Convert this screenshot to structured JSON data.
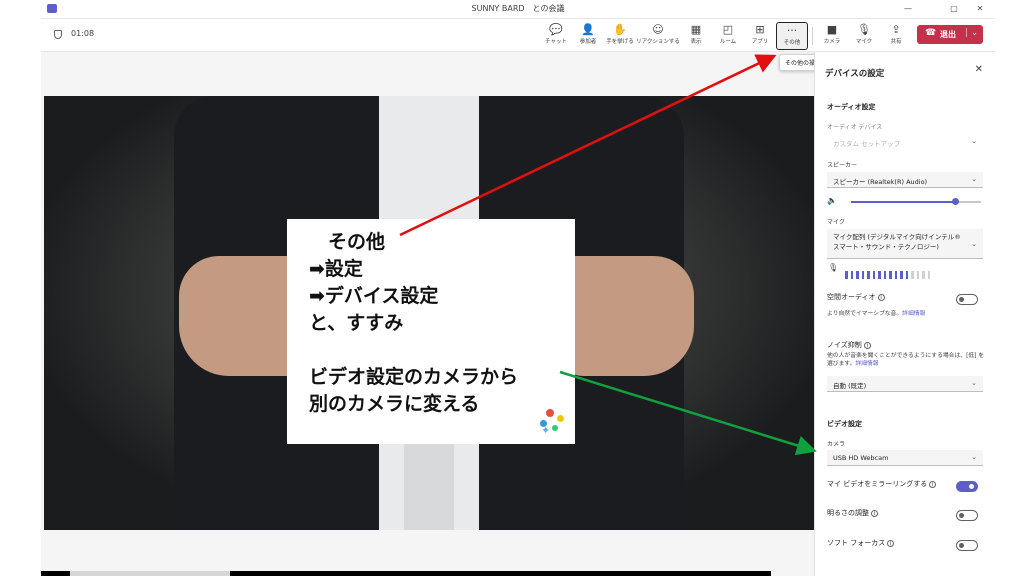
{
  "window": {
    "title": "SUNNY BARD　との会議",
    "minimize": "—",
    "maximize": "▢",
    "close": "✕"
  },
  "toolbar": {
    "timer": "01:08",
    "buttons": [
      {
        "label": "チャット",
        "icon": "chat-icon"
      },
      {
        "label": "参加者",
        "icon": "people-icon"
      },
      {
        "label": "手を挙げる",
        "icon": "raise-hand-icon"
      },
      {
        "label": "リアクションする",
        "icon": "reaction-icon"
      },
      {
        "label": "表示",
        "icon": "view-icon"
      },
      {
        "label": "ルーム",
        "icon": "rooms-icon"
      },
      {
        "label": "アプリ",
        "icon": "apps-icon"
      },
      {
        "label": "その他",
        "icon": "more-icon"
      },
      {
        "label": "カメラ",
        "icon": "camera-icon"
      },
      {
        "label": "マイク",
        "icon": "mic-icon"
      },
      {
        "label": "共有",
        "icon": "share-icon"
      }
    ],
    "leave_label": "退出",
    "more_tooltip": "その他の操作"
  },
  "card": {
    "text": "　その他\n➡設定\n➡デバイス設定\nと、すすみ\n\nビデオ設定のカメラから\n別のカメラに変える"
  },
  "panel": {
    "title": "デバイスの設定",
    "audio_section": "オーディオ設定",
    "audio_device_label": "オーディオ デバイス",
    "audio_device_value": "カスタム セットアップ",
    "speaker_label": "スピーカー",
    "speaker_value": "スピーカー (Realtek(R) Audio)",
    "speaker_volume": 0.8,
    "mic_label": "マイク",
    "mic_value": "マイク配列 (デジタルマイク向けインテル®\nスマート・サウンド・テクノロジー)",
    "mic_level": 12,
    "mic_level_max": 16,
    "spatial_label": "空間オーディオ",
    "spatial_desc": "より自然でイマーシブな音。",
    "spatial_link": "詳細情報",
    "spatial_on": false,
    "noise_label": "ノイズ抑制",
    "noise_desc": "他の人が音楽を聞くことができるようにする場合は、[低] を選びます。",
    "noise_link": "詳細情報",
    "noise_value": "自動 (既定)",
    "video_section": "ビデオ設定",
    "camera_label": "カメラ",
    "camera_value": "USB HD Webcam",
    "mirror_label": "マイ ビデオをミラーリングする",
    "mirror_on": true,
    "brightness_label": "明るさの調整",
    "brightness_on": false,
    "softfocus_label": "ソフト フォーカス",
    "softfocus_on": false
  },
  "colors": {
    "accent": "#5b5fc7",
    "leave": "#c4314b",
    "arrow_red": "#e01010",
    "arrow_green": "#10a040"
  }
}
